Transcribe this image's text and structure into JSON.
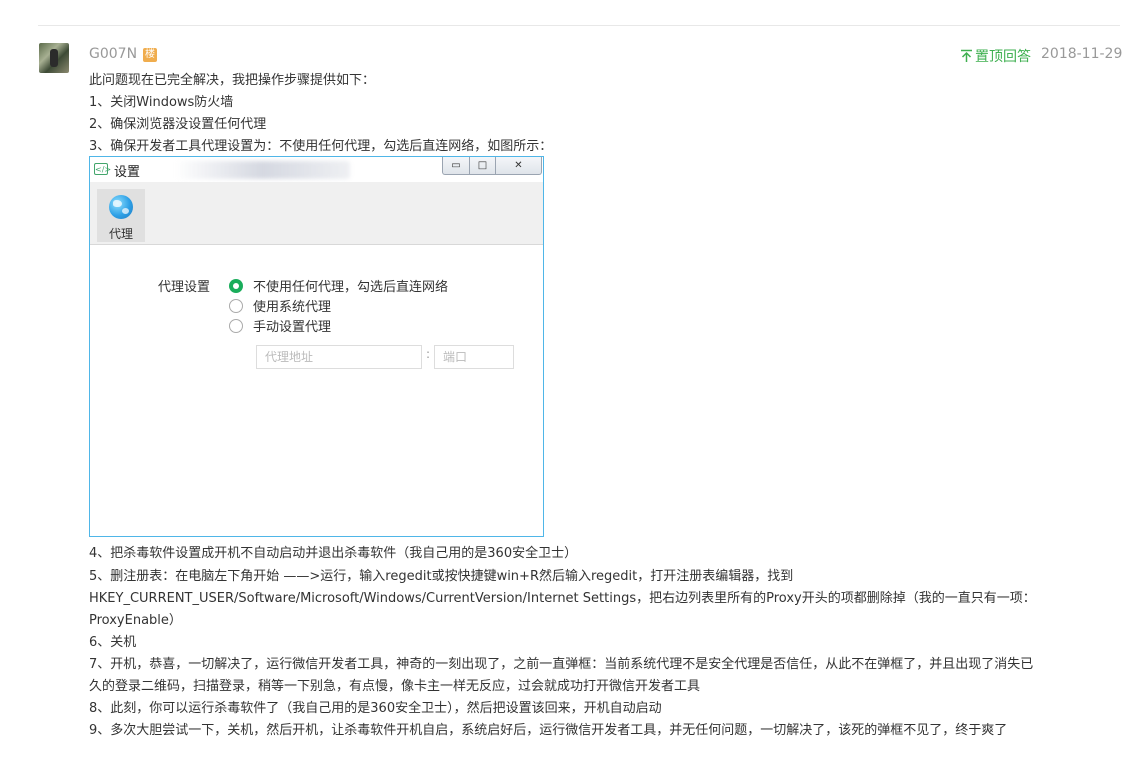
{
  "answer": {
    "username": "G007N",
    "floor_badge": "楼",
    "pin_label": "置顶回答",
    "date": "2018-11-29"
  },
  "lines": [
    "此问题现在已完全解决，我把操作步骤提供如下：",
    "1、关闭Windows防火墙",
    "2、确保浏览器没设置任何代理",
    "3、确保开发者工具代理设置为：不使用任何代理，勾选后直连网络，如图所示：",
    "4、把杀毒软件设置成开机不自动启动并退出杀毒软件（我自己用的是360安全卫士）",
    "5、删注册表：在电脑左下角开始 ——>运行，输入regedit或按快捷键win+R然后输入regedit，打开注册表编辑器，找到",
    " HKEY_CURRENT_USER/Software/Microsoft/Windows/CurrentVersion/Internet Settings，把右边列表里所有的Proxy开头的项都删除掉（我的一直只有一项：",
    "ProxyEnable）",
    "6、关机",
    "7、开机，恭喜，一切解决了，运行微信开发者工具，神奇的一刻出现了，之前一直弹框：当前系统代理不是安全代理是否信任，从此不在弹框了，并且出现了消失已",
    "久的登录二维码，扫描登录，稍等一下别急，有点慢，像卡主一样无反应，过会就成功打开微信开发者工具",
    "8、此刻，你可以运行杀毒软件了（我自己用的是360安全卫士），然后把设置该回来，开机自动启动",
    "9、多次大胆尝试一下，关机，然后开机，让杀毒软件开机自启，系统启好后，运行微信开发者工具，并无任何问题，一切解决了，该死的弹框不见了，终于爽了"
  ],
  "settings_window": {
    "app_icon": "</>",
    "title": "设置",
    "tab_proxy": "代理",
    "proxy_settings_label": "代理设置",
    "options": [
      {
        "label": "不使用任何代理，勾选后直连网络",
        "checked": true
      },
      {
        "label": "使用系统代理",
        "checked": false
      },
      {
        "label": "手动设置代理",
        "checked": false
      }
    ],
    "address_placeholder": "代理地址",
    "colon": ":",
    "port_placeholder": "端口",
    "btn_min": "▭",
    "btn_max": "□",
    "btn_close": "✕"
  },
  "icons": {
    "pin": "pin-top-icon",
    "globe": "globe-icon"
  },
  "colors": {
    "accent_green": "#3eaf4f",
    "badge_orange": "#f0ad4e",
    "radio_green": "#1aad5b",
    "window_border": "#4fb6e8"
  }
}
